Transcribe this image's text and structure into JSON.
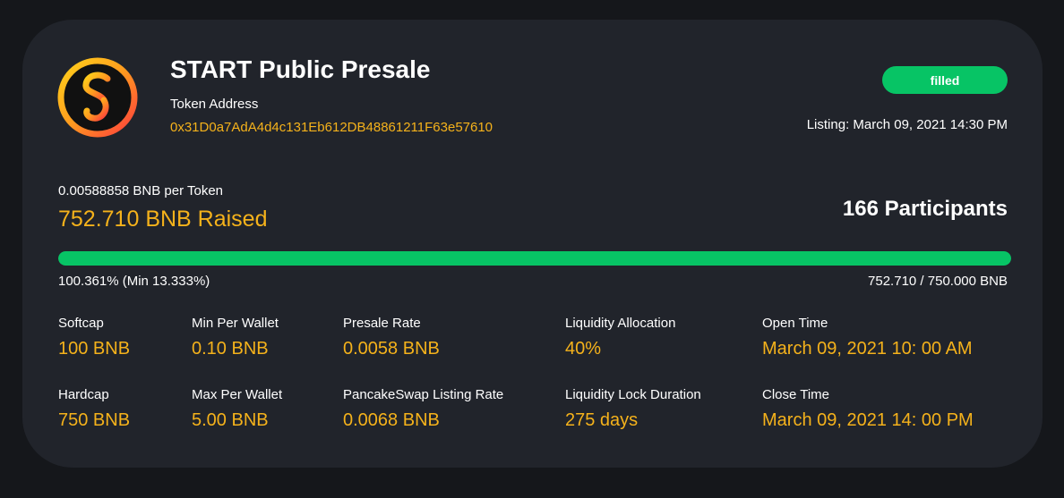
{
  "colors": {
    "background": "#15171b",
    "card": "#21242b",
    "accent": "#f5b21b",
    "success": "#07c465",
    "text": "#ffffff"
  },
  "presale": {
    "title": "START Public Presale",
    "token_address_label": "Token Address",
    "token_address": "0x31D0a7AdA4d4c131Eb612DB48861211F63e57610",
    "status": "filled",
    "listing": "Listing: March 09, 2021 14:30 PM",
    "logo_icon": "start-token-logo-icon"
  },
  "raise": {
    "rate": "0.00588858 BNB per Token",
    "raised": "752.710 BNB Raised",
    "participants": "166 Participants",
    "progress_fraction": 1.0,
    "progress_label": "100.361% (Min 13.333%)",
    "progress_amount": "752.710 / 750.000 BNB"
  },
  "stats": {
    "softcap": {
      "label": "Softcap",
      "value": "100 BNB"
    },
    "hardcap": {
      "label": "Hardcap",
      "value": "750 BNB"
    },
    "min_per_wallet": {
      "label": "Min Per Wallet",
      "value": "0.10 BNB"
    },
    "max_per_wallet": {
      "label": "Max Per Wallet",
      "value": "5.00 BNB"
    },
    "presale_rate": {
      "label": "Presale Rate",
      "value": "0.0058 BNB"
    },
    "listing_rate": {
      "label": "PancakeSwap Listing Rate",
      "value": "0.0068 BNB"
    },
    "liquidity_allocation": {
      "label": "Liquidity Allocation",
      "value": "40%"
    },
    "liquidity_lock": {
      "label": "Liquidity Lock Duration",
      "value": "275 days"
    },
    "open_time": {
      "label": "Open Time",
      "value": "March 09, 2021 10: 00 AM"
    },
    "close_time": {
      "label": "Close Time",
      "value": "March 09, 2021 14: 00 PM"
    }
  }
}
